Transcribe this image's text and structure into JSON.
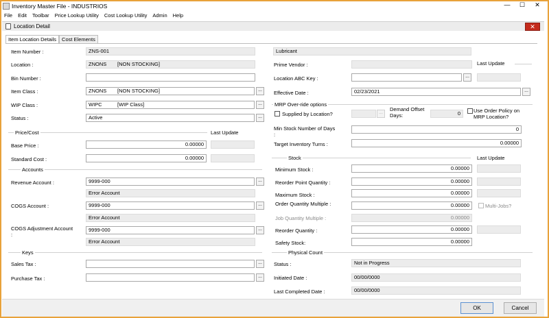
{
  "app": {
    "title": "Inventory Master File - INDUSTRIOS"
  },
  "menu": [
    "File",
    "Edit",
    "Toolbar",
    "Price Lookup Utility",
    "Cost Lookup Utility",
    "Admin",
    "Help"
  ],
  "window": {
    "title": "Location Detail",
    "close": "✕"
  },
  "tabs": [
    "Item Location Details",
    "Cost Elements"
  ],
  "left": {
    "item_number": {
      "label": "Item Number :",
      "value": "ZNS-001"
    },
    "location": {
      "label": "Location :",
      "code": "ZNONS",
      "desc": "[NON STOCKING]"
    },
    "bin_number": {
      "label": "Bin Number :",
      "value": ""
    },
    "item_class": {
      "label": "Item Class :",
      "code": "ZNONS",
      "desc": "[NON STOCKING]"
    },
    "wip_class": {
      "label": "WIP Class :",
      "code": "WIPC",
      "desc": "[WIP Class]"
    },
    "status": {
      "label": "Status :",
      "value": "Active"
    },
    "price_cost_header": "Price/Cost",
    "price_last_update": "Last Update",
    "base_price": {
      "label": "Base Price :",
      "value": "0.00000"
    },
    "standard_cost": {
      "label": "Standard Cost :",
      "value": "0.00000"
    },
    "accounts_header": "Accounts",
    "revenue_account": {
      "label": "Revenue Account :",
      "value": "9999-000",
      "note": "Error Account"
    },
    "cogs_account": {
      "label": "COGS Account :",
      "value": "9999-000",
      "note": "Error Account"
    },
    "cogs_adj_account": {
      "label": "COGS Adjustment Account",
      "label2": ":",
      "value": "9999-000",
      "note": "Error Account"
    },
    "keys_header": "Keys",
    "sales_tax": {
      "label": "Sales Tax :",
      "value": ""
    },
    "purchase_tax": {
      "label": "Purchase Tax :",
      "value": ""
    }
  },
  "right": {
    "description": "Lubricant",
    "prime_vendor": {
      "label": "Prime Vendor :",
      "value": ""
    },
    "last_update": "Last Update",
    "abc_key": {
      "label": "Location ABC Key :",
      "value": ""
    },
    "effective_date": {
      "label": "Effective Date :",
      "value": "02/23/2021"
    },
    "mrp_header": "MRP Over-ride options",
    "supplied_by_location": "Supplied by Location?",
    "demand_offset": {
      "label1": "Demand Offset",
      "label2": "Days:",
      "value": "0"
    },
    "use_order_policy": {
      "label1": "Use Order Policy on",
      "label2": "MRP Location?"
    },
    "min_stock_days": {
      "label1": "Min Stock Number of Days",
      "label2": ":",
      "value": "0"
    },
    "target_turns": {
      "label": "Target Inventory Turns :",
      "value": "0.00000"
    },
    "stock_header": "Stock",
    "stock_last_update": "Last Update",
    "minimum_stock": {
      "label": "Minimum Stock :",
      "value": "0.00000"
    },
    "reorder_point": {
      "label": "Reorder Point Quantity :",
      "value": "0.00000"
    },
    "maximum_stock": {
      "label": "Maximum Stock :",
      "value": "0.00000"
    },
    "order_qty_multiple": {
      "label": "Order Quantity Multiple :",
      "value": "0.00000"
    },
    "multi_jobs": "Multi-Jobs?",
    "job_qty_multiple": {
      "label": "Job Quantity Multiple :",
      "value": "0.00000"
    },
    "reorder_quantity": {
      "label": "Reorder Quantity :",
      "value": "0.00000"
    },
    "safety_stock": {
      "label": "Safety Stock:",
      "value": "0.00000"
    },
    "physical_count_header": "Physical Count",
    "pc_status": {
      "label": "Status :",
      "value": "Not in Progress"
    },
    "initiated_date": {
      "label": "Initiated Date :",
      "value": "00/00/0000"
    },
    "last_completed_date": {
      "label": "Last Completed Date :",
      "value": "00/00/0000"
    }
  },
  "footer": {
    "ok": "OK",
    "cancel": "Cancel"
  }
}
